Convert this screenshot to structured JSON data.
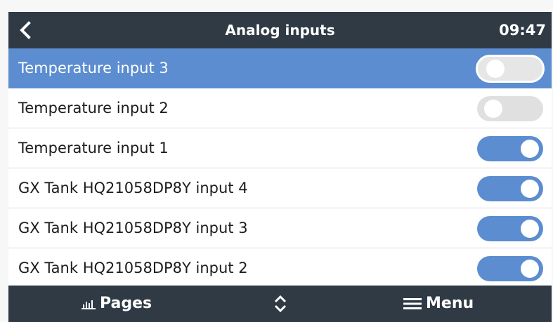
{
  "header": {
    "title": "Analog inputs",
    "time": "09:47"
  },
  "rows": [
    {
      "label": "Temperature input 3",
      "enabled": false,
      "selected": true
    },
    {
      "label": "Temperature input 2",
      "enabled": false,
      "selected": false
    },
    {
      "label": "Temperature input 1",
      "enabled": true,
      "selected": false
    },
    {
      "label": "GX Tank HQ21058DP8Y input 4",
      "enabled": true,
      "selected": false
    },
    {
      "label": "GX Tank HQ21058DP8Y input 3",
      "enabled": true,
      "selected": false
    },
    {
      "label": "GX Tank HQ21058DP8Y input 2",
      "enabled": true,
      "selected": false
    }
  ],
  "footer": {
    "pages_label": "Pages",
    "menu_label": "Menu"
  },
  "icons": {
    "back": "chevron-left-icon",
    "pages": "bar-chart-icon",
    "updown": "chevron-up-down-icon",
    "menu": "hamburger-menu-icon"
  },
  "colors": {
    "header_bg": "#2f3a45",
    "accent": "#5b8dd0",
    "toggle_off": "#e0e0e0"
  }
}
